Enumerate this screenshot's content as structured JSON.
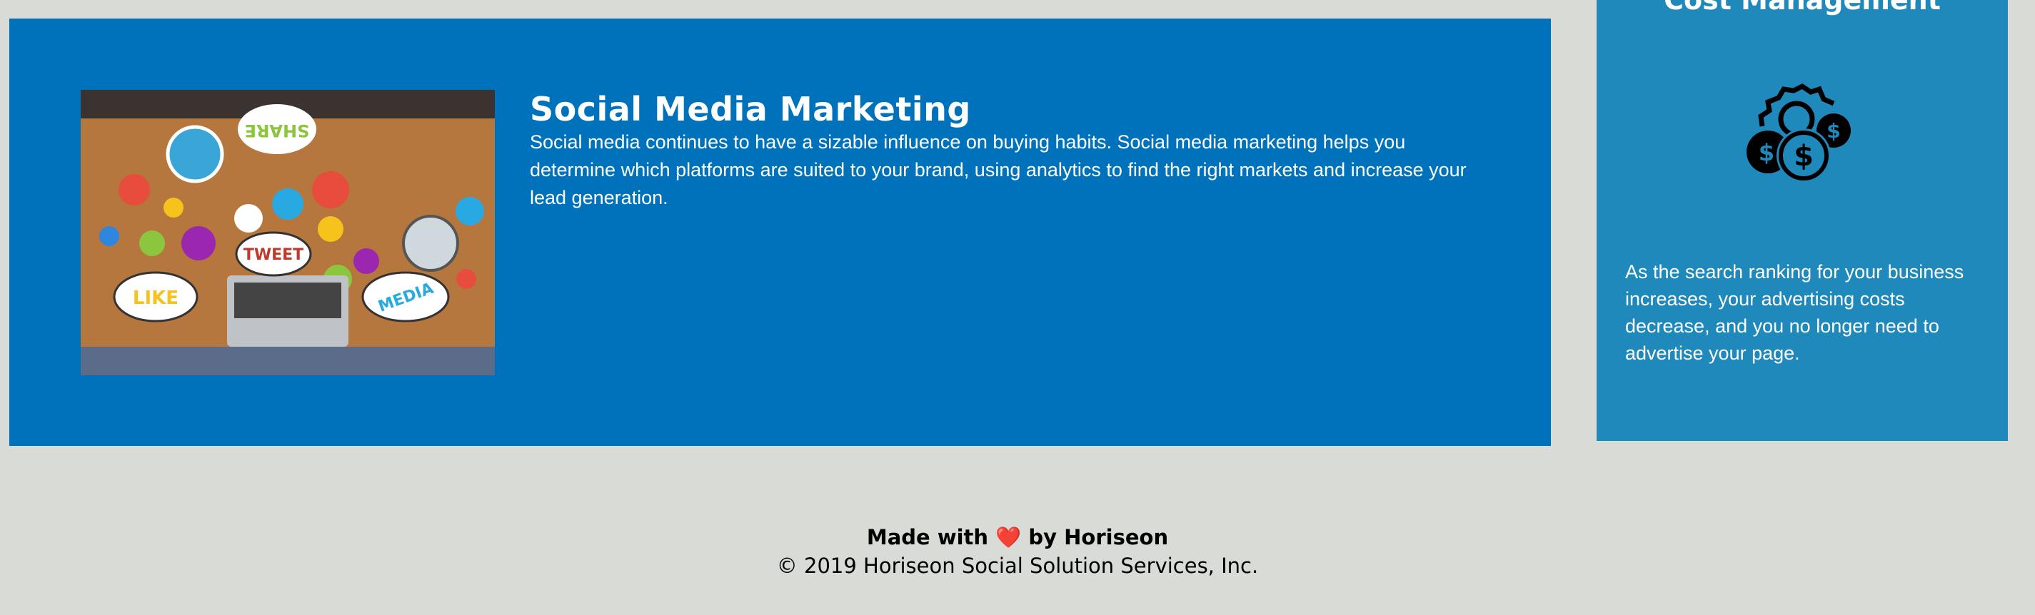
{
  "main_section": {
    "title": "Social Media Marketing",
    "description": "Social media continues to have a sizable influence on buying habits. Social media marketing helps you determine which platforms are suited to your brand, using analytics to find the right markets and increase your lead generation.",
    "image_bubbles": [
      "SHARE",
      "TWEET",
      "LIKE",
      "MEDIA"
    ]
  },
  "sidebar": {
    "title": "Cost Management",
    "icon": "gear-dollar-coins-icon",
    "description": "As the search ranking for your business increases, your advertising costs decrease, and you no longer need to advertise your page."
  },
  "footer": {
    "made_with": "Made with",
    "heart": "❤️",
    "by": "by Horiseon",
    "copyright": "© 2019 Horiseon Social Solution Services, Inc."
  },
  "colors": {
    "background": "#d9dcd6",
    "main_card": "#0072bb",
    "side_card": "#2089bc"
  }
}
